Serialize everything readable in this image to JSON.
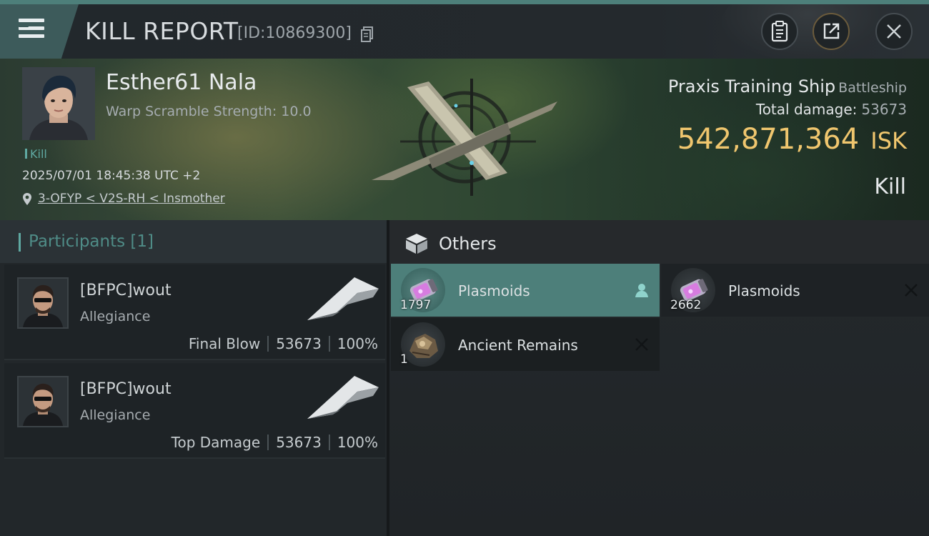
{
  "header": {
    "title": "KILL REPORT",
    "report_id": "[ID:10869300]"
  },
  "victim": {
    "name": "Esther61 Nala",
    "warp_scramble": "Warp Scramble Strength: 10.0",
    "kill_tag": "Kill",
    "datetime": "2025/07/01 18:45:38 UTC +2",
    "location": "3-OFYP < V2S-RH < Insmother",
    "ship_name": "Praxis Training Ship",
    "ship_class": "Battleship",
    "total_damage_label": "Total damage:",
    "total_damage": "53673",
    "isk_value": "542,871,364",
    "isk_unit": "ISK",
    "result": "Kill"
  },
  "participants": {
    "title": "Participants [1]",
    "rows": [
      {
        "name": "[BFPC]wout",
        "corp": "Allegiance",
        "role": "Final Blow",
        "damage": "53673",
        "percent": "100%"
      },
      {
        "name": "[BFPC]wout",
        "corp": "Allegiance",
        "role": "Top Damage",
        "damage": "53673",
        "percent": "100%"
      }
    ]
  },
  "others": {
    "title": "Others",
    "items": [
      {
        "name": "Plasmoids",
        "qty": "1797",
        "action_icon": "person-icon"
      },
      {
        "name": "Plasmoids",
        "qty": "2662",
        "action_icon": "close-icon"
      },
      {
        "name": "Ancient Remains",
        "qty": "1",
        "action_icon": "close-icon"
      }
    ]
  },
  "colors": {
    "accent_teal": "#4d7f7a",
    "isk_gold": "#f0c66e",
    "kill_tag_teal": "#5fa9a2"
  }
}
